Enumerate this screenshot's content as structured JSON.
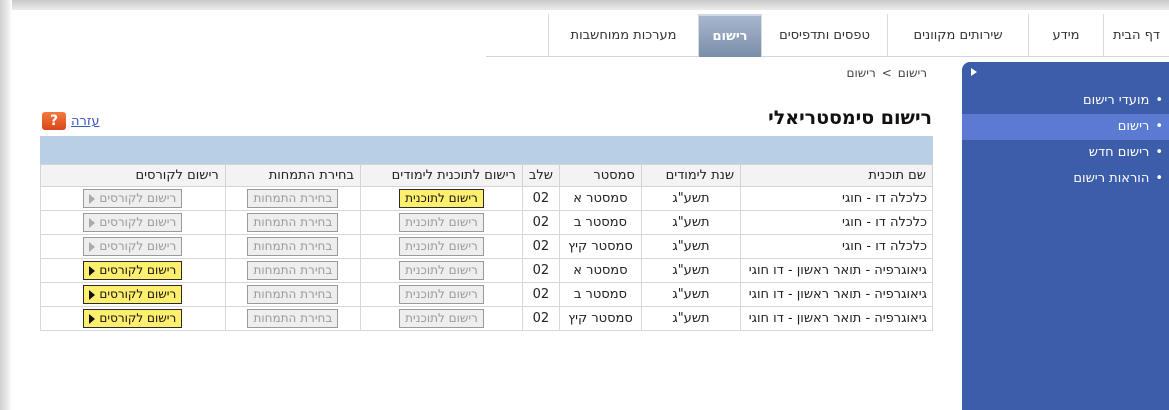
{
  "topnav": {
    "tabs": [
      {
        "label": "דף הבית",
        "active": false
      },
      {
        "label": "מידע",
        "active": false
      },
      {
        "label": "שירותים מקוונים",
        "active": false
      },
      {
        "label": "טפסים ותדפיסים",
        "active": false
      },
      {
        "label": "רישום",
        "active": true
      },
      {
        "label": "מערכות ממוחשבות",
        "active": false
      }
    ]
  },
  "sidebar": {
    "items": [
      {
        "label": "מועדי רישום",
        "active": false
      },
      {
        "label": "רישום",
        "active": true
      },
      {
        "label": "רישום חדש",
        "active": false
      },
      {
        "label": "הוראות רישום",
        "active": false
      }
    ]
  },
  "breadcrumb": {
    "items": [
      "רישום",
      "רישום"
    ],
    "separator": ">"
  },
  "page": {
    "title": "רישום סימסטריאלי",
    "help_label": "עזרה",
    "help_icon_text": "?"
  },
  "table": {
    "headers": [
      "שם תוכנית",
      "שנת לימודים",
      "סמסטר",
      "שלב",
      "רישום לתוכנית לימודים",
      "בחירת התמחות",
      "רישום לקורסים"
    ],
    "rows": [
      {
        "program": "כלכלה דו - חוגי",
        "year": "תשע\"ג",
        "semester": "סמסטר א",
        "stage": "02",
        "program_btn": "רישום לתוכנית",
        "program_enabled": true,
        "spec_btn": "בחירת התמחות",
        "spec_enabled": false,
        "courses_btn": "רישום לקורסים",
        "courses_enabled": false
      },
      {
        "program": "כלכלה דו - חוגי",
        "year": "תשע\"ג",
        "semester": "סמסטר ב",
        "stage": "02",
        "program_btn": "רישום לתוכנית",
        "program_enabled": false,
        "spec_btn": "בחירת התמחות",
        "spec_enabled": false,
        "courses_btn": "רישום לקורסים",
        "courses_enabled": false
      },
      {
        "program": "כלכלה דו - חוגי",
        "year": "תשע\"ג",
        "semester": "סמסטר קיץ",
        "stage": "02",
        "program_btn": "רישום לתוכנית",
        "program_enabled": false,
        "spec_btn": "בחירת התמחות",
        "spec_enabled": false,
        "courses_btn": "רישום לקורסים",
        "courses_enabled": false
      },
      {
        "program": "גיאוגרפיה - תואר ראשון - דו חוגי",
        "year": "תשע\"ג",
        "semester": "סמסטר א",
        "stage": "02",
        "program_btn": "רישום לתוכנית",
        "program_enabled": false,
        "spec_btn": "בחירת התמחות",
        "spec_enabled": false,
        "courses_btn": "רישום לקורסים",
        "courses_enabled": true
      },
      {
        "program": "גיאוגרפיה - תואר ראשון - דו חוגי",
        "year": "תשע\"ג",
        "semester": "סמסטר ב",
        "stage": "02",
        "program_btn": "רישום לתוכנית",
        "program_enabled": false,
        "spec_btn": "בחירת התמחות",
        "spec_enabled": false,
        "courses_btn": "רישום לקורסים",
        "courses_enabled": true
      },
      {
        "program": "גיאוגרפיה - תואר ראשון - דו חוגי",
        "year": "תשע\"ג",
        "semester": "סמסטר קיץ",
        "stage": "02",
        "program_btn": "רישום לתוכנית",
        "program_enabled": false,
        "spec_btn": "בחירת התמחות",
        "spec_enabled": false,
        "courses_btn": "רישום לקורסים",
        "courses_enabled": true
      }
    ]
  },
  "colors": {
    "sidebar": "#3c5da9",
    "sidebar_active": "#5a7bd1",
    "button_enabled": "#ffef6e",
    "table_band": "#b8cfe6"
  }
}
